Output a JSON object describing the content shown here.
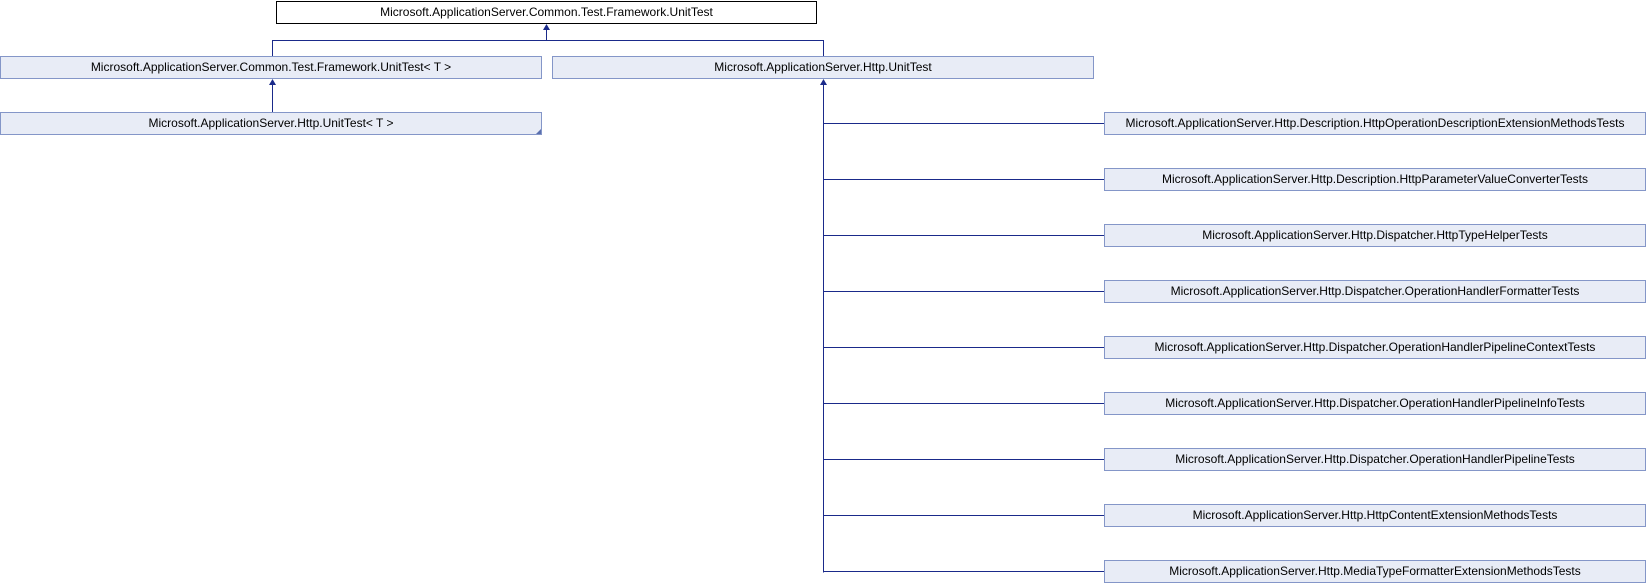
{
  "diagram": {
    "root": {
      "label": "Microsoft.ApplicationServer.Common.Test.Framework.UnitTest"
    },
    "generic_base": {
      "label": "Microsoft.ApplicationServer.Common.Test.Framework.UnitTest< T >"
    },
    "http_unit_test": {
      "label": "Microsoft.ApplicationServer.Http.UnitTest"
    },
    "http_generic_unit_test": {
      "label": "Microsoft.ApplicationServer.Http.UnitTest< T >"
    },
    "derived_tests": [
      {
        "label": "Microsoft.ApplicationServer.Http.Description.HttpOperationDescriptionExtensionMethodsTests"
      },
      {
        "label": "Microsoft.ApplicationServer.Http.Description.HttpParameterValueConverterTests"
      },
      {
        "label": "Microsoft.ApplicationServer.Http.Dispatcher.HttpTypeHelperTests"
      },
      {
        "label": "Microsoft.ApplicationServer.Http.Dispatcher.OperationHandlerFormatterTests"
      },
      {
        "label": "Microsoft.ApplicationServer.Http.Dispatcher.OperationHandlerPipelineContextTests"
      },
      {
        "label": "Microsoft.ApplicationServer.Http.Dispatcher.OperationHandlerPipelineInfoTests"
      },
      {
        "label": "Microsoft.ApplicationServer.Http.Dispatcher.OperationHandlerPipelineTests"
      },
      {
        "label": "Microsoft.ApplicationServer.Http.HttpContentExtensionMethodsTests"
      },
      {
        "label": "Microsoft.ApplicationServer.Http.MediaTypeFormatterExtensionMethodsTests"
      }
    ],
    "colors": {
      "edge": "#1a2a8a",
      "node_fill": "#e8ecf6",
      "node_border": "#8496c8",
      "root_border": "#000000"
    }
  }
}
